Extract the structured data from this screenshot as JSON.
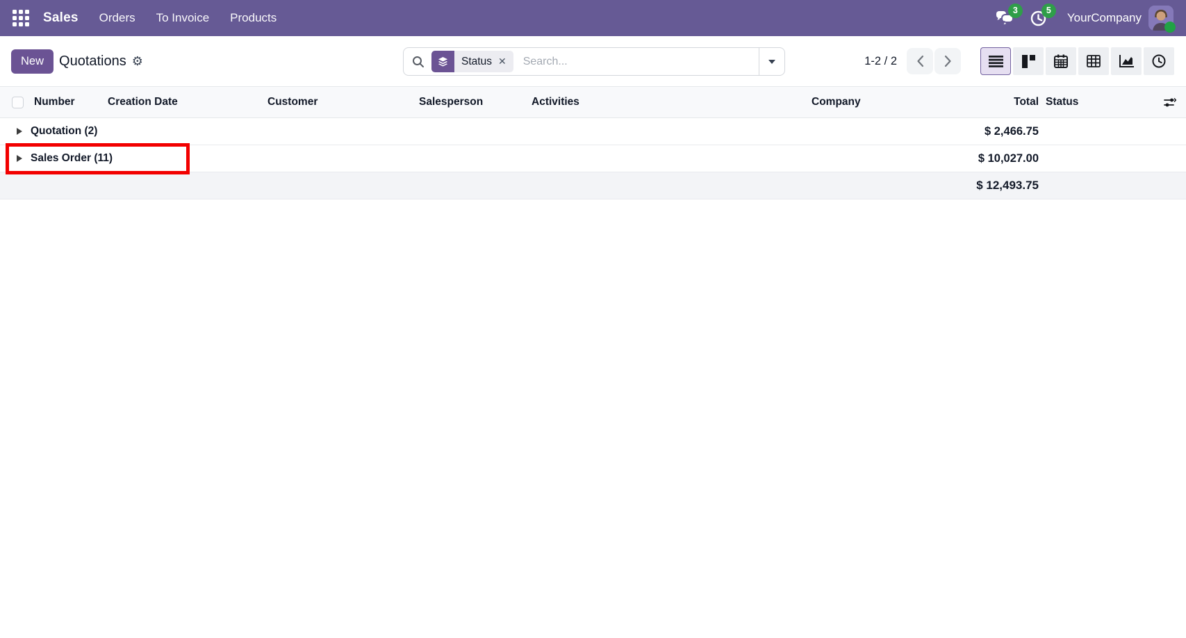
{
  "navbar": {
    "app_name": "Sales",
    "menu_items": [
      "Orders",
      "To Invoice",
      "Products"
    ],
    "messages_badge": "3",
    "activities_badge": "5",
    "company_name": "YourCompany"
  },
  "control_panel": {
    "new_button": "New",
    "title": "Quotations",
    "cog_icon": "⚙",
    "search": {
      "facet_label": "Status",
      "facet_close": "✕",
      "placeholder": "Search..."
    },
    "pager": {
      "text": "1-2 / 2",
      "range": "1-2",
      "total": "2"
    }
  },
  "view_switcher": {
    "buttons": [
      "list",
      "kanban",
      "calendar",
      "pivot",
      "graph",
      "activity"
    ],
    "active": "list"
  },
  "table": {
    "columns": [
      "Number",
      "Creation Date",
      "Customer",
      "Salesperson",
      "Activities",
      "Company",
      "Total",
      "Status"
    ],
    "groups": [
      {
        "label": "Quotation (2)",
        "count": "2",
        "total": "$ 2,466.75"
      },
      {
        "label": "Sales Order (11)",
        "count": "11",
        "total": "$ 10,027.00"
      }
    ],
    "footer_total": "$ 12,493.75"
  },
  "annotation": {
    "shape": "red-rectangle",
    "target": "Sales Order (11) group row",
    "color": "#f20000"
  },
  "colors": {
    "navbar_bg": "#665a95",
    "primary_purple": "#6b5394",
    "badge_green": "#2f9e49",
    "active_view_bg": "#e6dff1",
    "header_row_bg": "#f8f9fb",
    "footer_row_bg": "#f3f4f7"
  }
}
